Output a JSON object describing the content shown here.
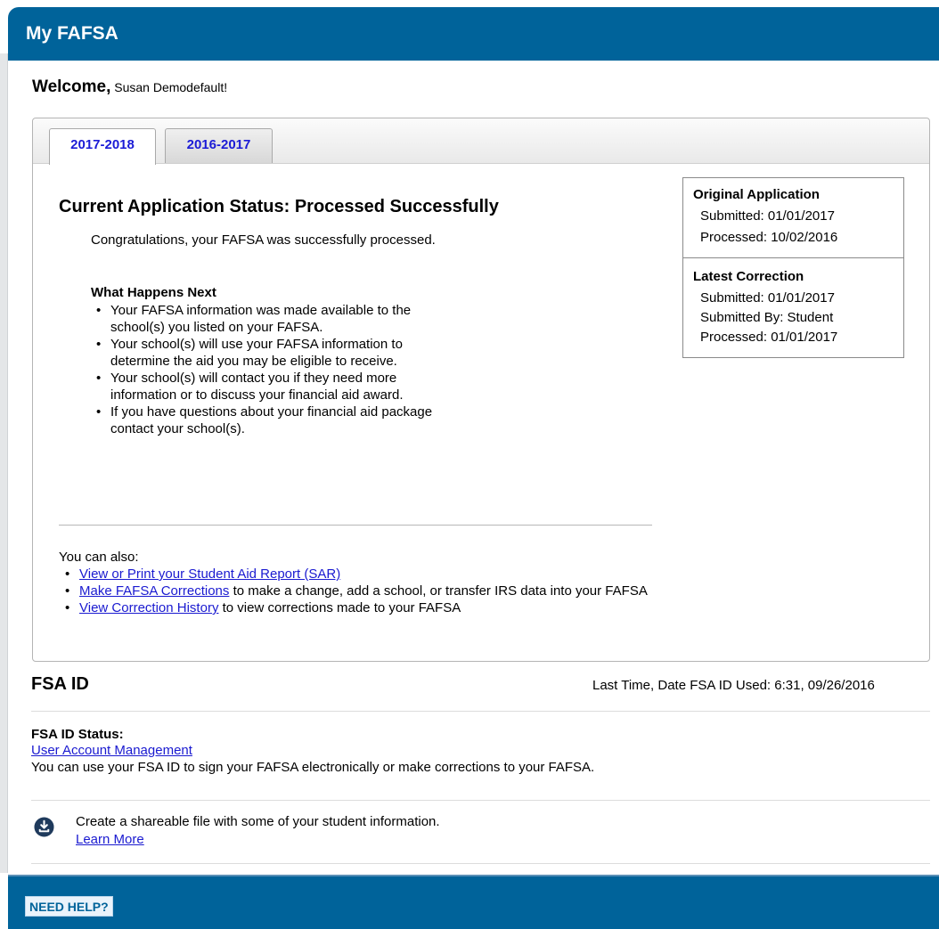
{
  "header": {
    "title": "My FAFSA"
  },
  "welcome": {
    "greeting": "Welcome,",
    "name": "Susan Demodefault!"
  },
  "tabs": [
    {
      "label": "2017-2018",
      "active": true
    },
    {
      "label": "2016-2017",
      "active": false
    }
  ],
  "status": {
    "title": "Current Application Status: Processed Successfully",
    "congrats": "Congratulations, your FAFSA was successfully processed.",
    "next_title": "What Happens Next",
    "next_items": [
      "Your FAFSA information was made available to the school(s) you listed on your FAFSA.",
      "Your school(s) will use your FAFSA information to determine the aid you may be eligible to receive.",
      "Your school(s) will contact you if they need more information or to discuss your financial aid award.",
      "If you have questions about your financial aid package contact your school(s)."
    ],
    "also_title": "You can also:",
    "also_items": [
      {
        "link": "View or Print your Student Aid Report (SAR)",
        "text": ""
      },
      {
        "link": "Make FAFSA Corrections",
        "text": " to make a change, add a school, or transfer IRS data into your FAFSA"
      },
      {
        "link": "View Correction History",
        "text": " to view corrections made to your FAFSA"
      }
    ]
  },
  "original_application": {
    "title": "Original Application",
    "submitted": "Submitted: 01/01/2017",
    "processed": "Processed: 10/02/2016"
  },
  "latest_correction": {
    "title": "Latest Correction",
    "submitted": "Submitted:  01/01/2017",
    "submitted_by": "Submitted By:  Student",
    "processed": "Processed:  01/01/2017"
  },
  "fsa": {
    "title": "FSA ID",
    "last_used": "Last Time, Date FSA ID Used: 6:31, 09/26/2016",
    "status_label": "FSA ID Status:",
    "account_link": "User Account Management",
    "description": "You can use your FSA ID to sign your FAFSA electronically or make corrections to your FAFSA."
  },
  "share": {
    "icon": "download-icon",
    "text": "Create a shareable file with some of your student information.",
    "link": "Learn More"
  },
  "footer": {
    "help_label": "NEED HELP?"
  },
  "colors": {
    "brand": "#00639a",
    "link": "#1a1ad0"
  }
}
